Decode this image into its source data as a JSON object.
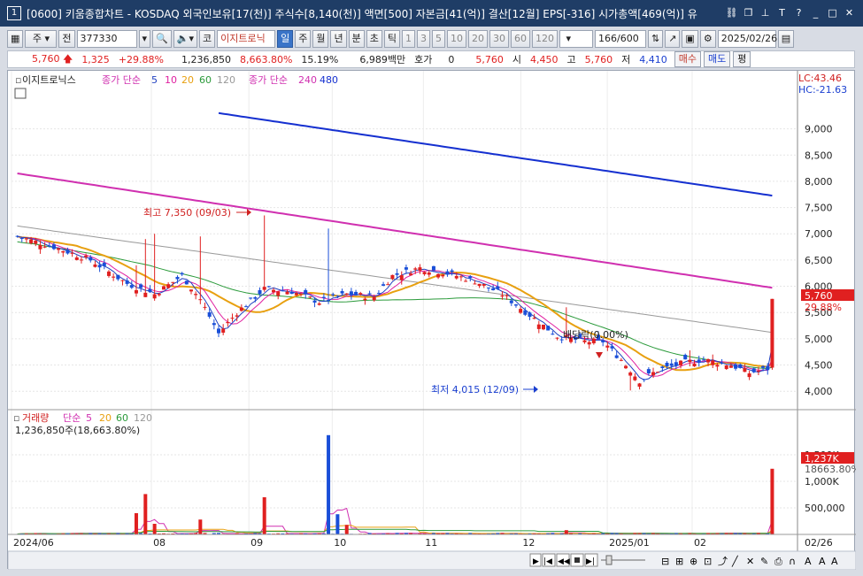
{
  "window": {
    "badge": "1",
    "title": "[0600] 키움종합차트 - KOSDAQ 외국인보유[17(천)] 주식수[8,140(천)] 액면[500] 자본금[41(억)] 결산[12월] EPS[-316] 시가총액[469(억)] 유"
  },
  "toolbar": {
    "period_type": "주",
    "prev": "전",
    "code": "377330",
    "market": "코",
    "stock_name": "이지트로닉",
    "intervals": [
      "일",
      "주",
      "월",
      "년",
      "분",
      "초",
      "틱"
    ],
    "active_interval": "일",
    "minute_options": [
      "1",
      "3",
      "5",
      "10",
      "20",
      "30",
      "60",
      "120"
    ],
    "count": "166",
    "count_total": "/600",
    "date": "2025/02/26"
  },
  "quote": {
    "price": "5,760",
    "change": "1,325",
    "change_pct": "+29.88%",
    "volume": "1,236,850",
    "volume_ratio": "8,663.80%",
    "turnover": "15.19%",
    "amount": "6,989백만",
    "hoga_label": "호가",
    "hoga_value": "0",
    "current": "5,760",
    "open_label": "시",
    "open": "4,450",
    "high_label": "고",
    "high": "5,760",
    "low_label": "저",
    "low": "4,410",
    "buy_button": "매수",
    "sell_button": "매도",
    "avg_button": "평"
  },
  "price_panel": {
    "legend_name": "이지트로닉스",
    "ma_label": "종가 단순",
    "ma_periods": [
      "5",
      "10",
      "20",
      "60",
      "120"
    ],
    "ma_label2": "종가 단순",
    "ma_periods2": [
      "240",
      "480"
    ],
    "lc": "LC:43.46",
    "hc": "HC:-21.63",
    "y_ticks": [
      "9,000",
      "8,500",
      "8,000",
      "7,500",
      "7,000",
      "6,500",
      "6,000",
      "5,500",
      "5,000",
      "4,500",
      "4,000"
    ],
    "current_tag": "5,760",
    "current_pct": "29.88%",
    "high_annotation": "최고 7,350 (09/03)",
    "low_annotation": "최저 4,015 (12/09)",
    "dividend_annotation": "배당락(0.00%)"
  },
  "volume_panel": {
    "legend_name": "거래량",
    "ma_label": "단순",
    "ma_periods": [
      "5",
      "20",
      "60",
      "120"
    ],
    "volume_text": "1,236,850주(18,663.80%)",
    "y_ticks": [
      "1,500K",
      "1,000K",
      "500,000"
    ],
    "current_tag": "1,237K",
    "current_pct": "18663.80%"
  },
  "x_axis": {
    "labels": [
      "2024/06",
      "08",
      "09",
      "10",
      "11",
      "12",
      "2025/01",
      "02"
    ],
    "right_label": "02/26"
  },
  "colors": {
    "up": "#e02020",
    "down": "#1a4fd8",
    "ma5": "#2040c0",
    "ma10": "#e020a0",
    "ma20": "#e8a010",
    "ma60": "#2a9a3a",
    "ma120": "#999999",
    "ma240": "#d030b0",
    "ma480": "#1530d0"
  }
}
